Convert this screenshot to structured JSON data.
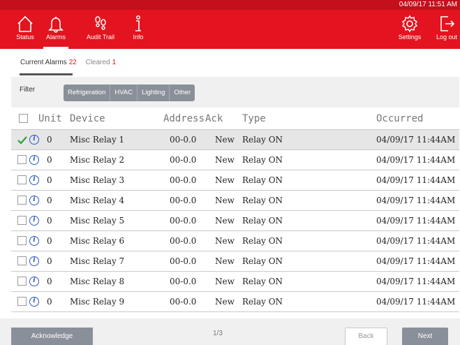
{
  "header": {
    "datetime": "04/09/17 11:51 AM",
    "nav": [
      {
        "label": "Status",
        "icon": "home-icon"
      },
      {
        "label": "Alarms",
        "icon": "bell-icon"
      },
      {
        "label": "Audit Trail",
        "icon": "footprints-icon"
      },
      {
        "label": "Info",
        "icon": "info-icon"
      }
    ],
    "settings_label": "Settings",
    "logout_label": "Log out"
  },
  "tabs": {
    "current_label": "Current Alarms",
    "current_count": "22",
    "cleared_label": "Cleared",
    "cleared_count": "1"
  },
  "filter": {
    "label": "Filter",
    "options": [
      "Refrigeration",
      "HVAC",
      "Lighting",
      "Other"
    ]
  },
  "table": {
    "columns": {
      "unit": "Unit",
      "device": "Device",
      "address": "Address",
      "ack": "Ack",
      "type": "Type",
      "occurred": "Occurred"
    },
    "rows": [
      {
        "checked": true,
        "unit": "0",
        "device": "Misc Relay 1",
        "address": "00-0.0",
        "ack": "New",
        "type": "Relay ON",
        "occurred": "04/09/17 11:44AM"
      },
      {
        "checked": false,
        "unit": "0",
        "device": "Misc Relay 2",
        "address": "00-0.0",
        "ack": "New",
        "type": "Relay ON",
        "occurred": "04/09/17 11:44AM"
      },
      {
        "checked": false,
        "unit": "0",
        "device": "Misc Relay 3",
        "address": "00-0.0",
        "ack": "New",
        "type": "Relay ON",
        "occurred": "04/09/17 11:44AM"
      },
      {
        "checked": false,
        "unit": "0",
        "device": "Misc Relay 4",
        "address": "00-0.0",
        "ack": "New",
        "type": "Relay ON",
        "occurred": "04/09/17 11:44AM"
      },
      {
        "checked": false,
        "unit": "0",
        "device": "Misc Relay 5",
        "address": "00-0.0",
        "ack": "New",
        "type": "Relay ON",
        "occurred": "04/09/17 11:44AM"
      },
      {
        "checked": false,
        "unit": "0",
        "device": "Misc Relay 6",
        "address": "00-0.0",
        "ack": "New",
        "type": "Relay ON",
        "occurred": "04/09/17 11:44AM"
      },
      {
        "checked": false,
        "unit": "0",
        "device": "Misc Relay 7",
        "address": "00-0.0",
        "ack": "New",
        "type": "Relay ON",
        "occurred": "04/09/17 11:44AM"
      },
      {
        "checked": false,
        "unit": "0",
        "device": "Misc Relay 8",
        "address": "00-0.0",
        "ack": "New",
        "type": "Relay ON",
        "occurred": "04/09/17 11:44AM"
      },
      {
        "checked": false,
        "unit": "0",
        "device": "Misc Relay 9",
        "address": "00-0.0",
        "ack": "New",
        "type": "Relay ON",
        "occurred": "04/09/17 11:44AM"
      }
    ]
  },
  "footer": {
    "acknowledge_label": "Acknowledge",
    "page_indicator": "1/3",
    "back_label": "Back",
    "next_label": "Next"
  },
  "colors": {
    "brand_red": "#e3141f",
    "check_green": "#2e9e3f",
    "info_blue": "#2a58c7",
    "button_gray": "#8a9099"
  }
}
